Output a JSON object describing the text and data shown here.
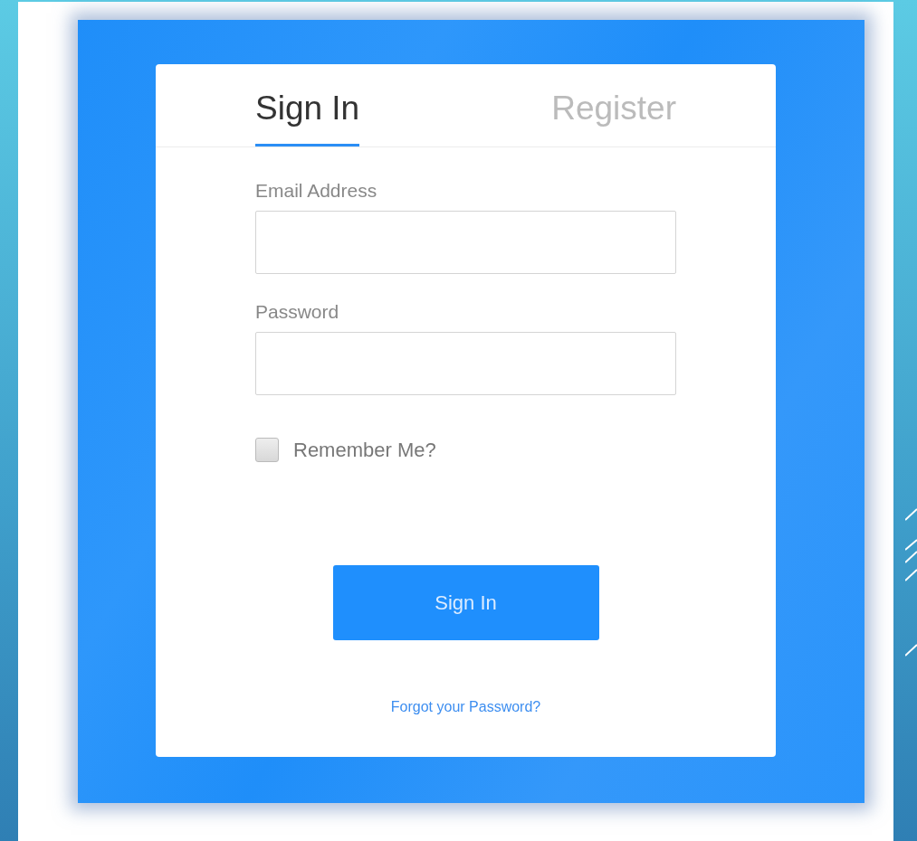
{
  "tabs": [
    {
      "label": "Sign In",
      "selected": true
    },
    {
      "label": "Register",
      "selected": false
    }
  ],
  "fields": [
    {
      "label": "Email Address"
    },
    {
      "label": "Password"
    }
  ],
  "remember": {
    "label": "Remember Me?",
    "checked": false
  },
  "submit": {
    "label": "Sign In"
  },
  "forgot_link": "Forgot your Password?"
}
